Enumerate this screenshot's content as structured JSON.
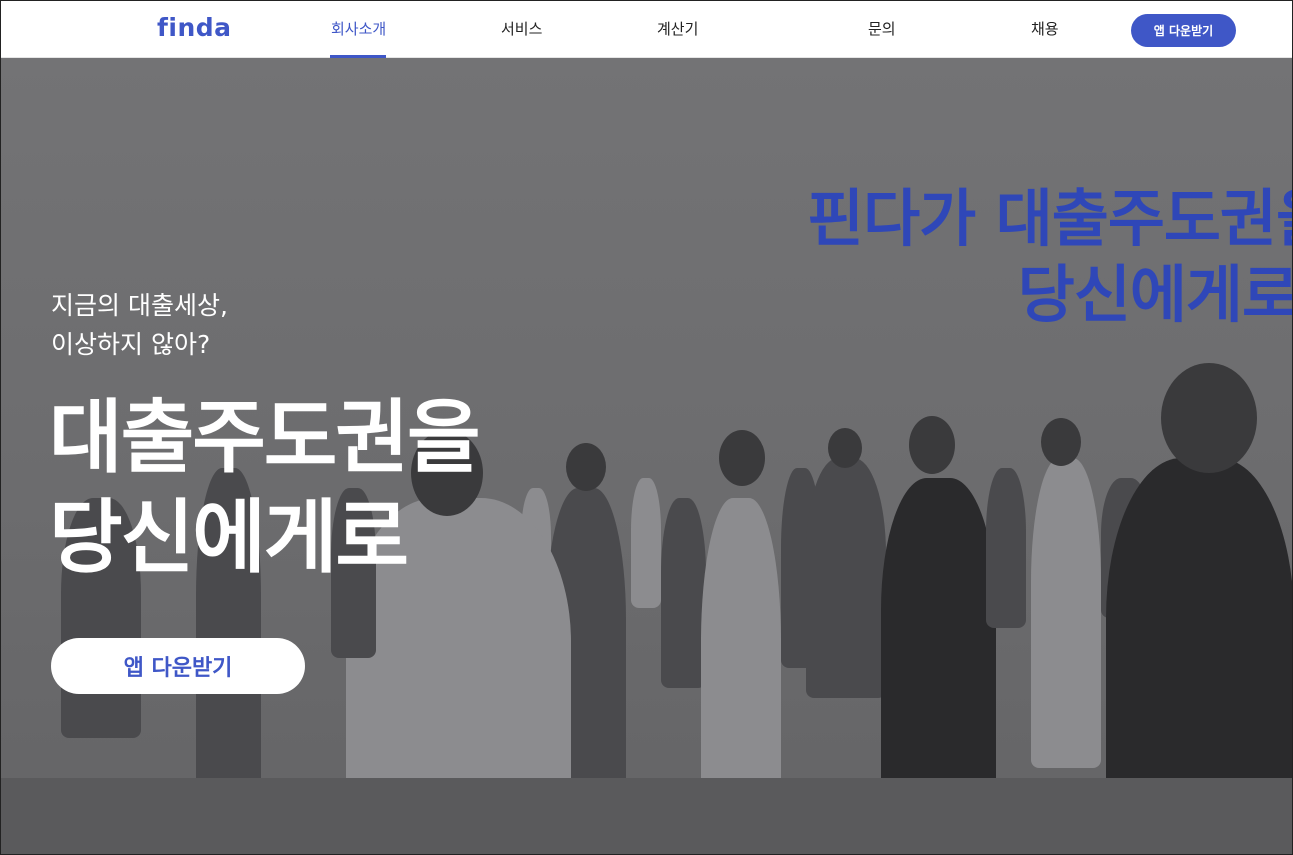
{
  "header": {
    "logo": "finda",
    "nav": [
      {
        "label": "회사소개",
        "active": true
      },
      {
        "label": "서비스",
        "active": false
      },
      {
        "label": "계산기",
        "active": false
      },
      {
        "label": "문의",
        "active": false
      },
      {
        "label": "채용",
        "active": false
      }
    ],
    "download_label": "앱 다운받기"
  },
  "hero": {
    "billboard_line1": "핀다가 대출주도권을",
    "billboard_line2": "당신에게로",
    "eyebrow_line1": "지금의 대출세상,",
    "eyebrow_line2": "이상하지 않아?",
    "headline_line1": "대출주도권을",
    "headline_line2": "당신에게로",
    "cta_label": "앱 다운받기"
  },
  "colors": {
    "brand": "#3f57c7",
    "header_bg": "#ffffff",
    "hero_overlay": "#6f6f72"
  }
}
